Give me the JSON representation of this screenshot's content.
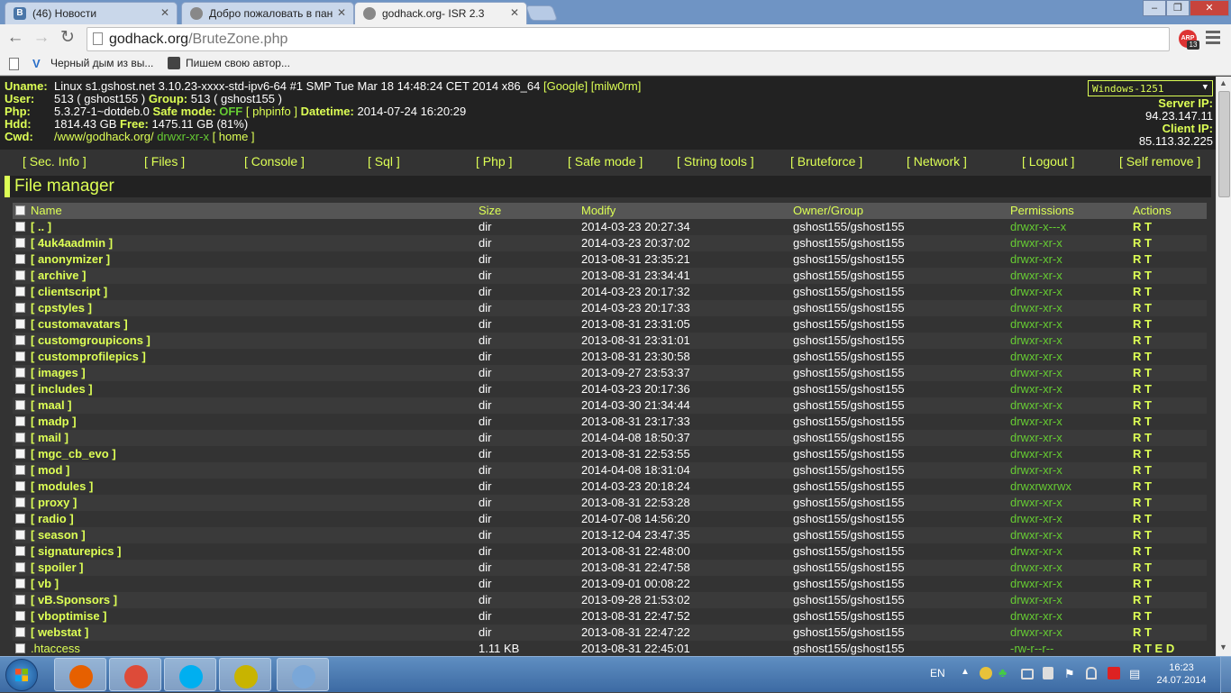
{
  "browser": {
    "tabs": [
      {
        "title": "(46) Новости",
        "icon": "vk-icon",
        "color": "#4a76a8"
      },
      {
        "title": "Добро пожаловать в пан",
        "icon": "page-icon",
        "color": "#888888"
      },
      {
        "title": "godhack.org- ISR 2.3",
        "icon": "page-icon",
        "color": "#888888"
      }
    ],
    "url_host": "godhack.org",
    "url_path": "/BruteZone.php",
    "extension_label": "ARP",
    "extension_badge": "13",
    "bookmarks": [
      {
        "label": "Черный дым из вы...",
        "icon": "bookmark-v-icon"
      },
      {
        "label": "Пишем свою автор...",
        "icon": "bookmark-avatar-icon"
      }
    ]
  },
  "info": {
    "uname_label": "Uname:",
    "uname_value": "Linux s1.gshost.net 3.10.23-xxxx-std-ipv6-64 #1 SMP Tue Mar 18 14:48:24 CET 2014 x86_64",
    "uname_google": "[Google]",
    "uname_milw0rm": "[milw0rm]",
    "user_label": "User:",
    "user_value": "513 ( gshost155 )",
    "group_label": "Group:",
    "group_value": "513 ( gshost155 )",
    "php_label": "Php:",
    "php_value": "5.3.27-1~dotdeb.0",
    "safe_label": "Safe mode:",
    "safe_value": "OFF",
    "phpinfo": "[ phpinfo ]",
    "datetime_label": "Datetime:",
    "datetime_value": "2014-07-24 16:20:29",
    "hdd_label": "Hdd:",
    "hdd_value": "1814.43 GB",
    "free_label": "Free:",
    "free_value": "1475.11 GB (81%)",
    "cwd_label": "Cwd:",
    "cwd_value": "/www/godhack.org/",
    "cwd_perm": "drwxr-xr-x",
    "cwd_home": "[ home ]",
    "encoding": "Windows-1251",
    "server_ip_label": "Server IP:",
    "server_ip": "94.23.147.11",
    "client_ip_label": "Client IP:",
    "client_ip": "85.113.32.225"
  },
  "menu": [
    "[ Sec. Info ]",
    "[ Files ]",
    "[ Console ]",
    "[ Sql ]",
    "[ Php ]",
    "[ Safe mode ]",
    "[ String tools ]",
    "[ Bruteforce ]",
    "[ Network ]",
    "[ Logout ]",
    "[ Self remove ]"
  ],
  "file_manager": {
    "title": "File manager",
    "columns": {
      "name": "Name",
      "size": "Size",
      "modify": "Modify",
      "owner": "Owner/Group",
      "perms": "Permissions",
      "actions": "Actions"
    },
    "rows": [
      {
        "name": "[ .. ]",
        "size": "dir",
        "modify": "2014-03-23 20:27:34",
        "owner": "gshost155/gshost155",
        "perms": "drwxr-x---x",
        "actions": "R T"
      },
      {
        "name": "[ 4uk4aadmin ]",
        "size": "dir",
        "modify": "2014-03-23 20:37:02",
        "owner": "gshost155/gshost155",
        "perms": "drwxr-xr-x",
        "actions": "R T"
      },
      {
        "name": "[ anonymizer ]",
        "size": "dir",
        "modify": "2013-08-31 23:35:21",
        "owner": "gshost155/gshost155",
        "perms": "drwxr-xr-x",
        "actions": "R T"
      },
      {
        "name": "[ archive ]",
        "size": "dir",
        "modify": "2013-08-31 23:34:41",
        "owner": "gshost155/gshost155",
        "perms": "drwxr-xr-x",
        "actions": "R T"
      },
      {
        "name": "[ clientscript ]",
        "size": "dir",
        "modify": "2014-03-23 20:17:32",
        "owner": "gshost155/gshost155",
        "perms": "drwxr-xr-x",
        "actions": "R T"
      },
      {
        "name": "[ cpstyles ]",
        "size": "dir",
        "modify": "2014-03-23 20:17:33",
        "owner": "gshost155/gshost155",
        "perms": "drwxr-xr-x",
        "actions": "R T"
      },
      {
        "name": "[ customavatars ]",
        "size": "dir",
        "modify": "2013-08-31 23:31:05",
        "owner": "gshost155/gshost155",
        "perms": "drwxr-xr-x",
        "actions": "R T"
      },
      {
        "name": "[ customgroupicons ]",
        "size": "dir",
        "modify": "2013-08-31 23:31:01",
        "owner": "gshost155/gshost155",
        "perms": "drwxr-xr-x",
        "actions": "R T"
      },
      {
        "name": "[ customprofilepics ]",
        "size": "dir",
        "modify": "2013-08-31 23:30:58",
        "owner": "gshost155/gshost155",
        "perms": "drwxr-xr-x",
        "actions": "R T"
      },
      {
        "name": "[ images ]",
        "size": "dir",
        "modify": "2013-09-27 23:53:37",
        "owner": "gshost155/gshost155",
        "perms": "drwxr-xr-x",
        "actions": "R T"
      },
      {
        "name": "[ includes ]",
        "size": "dir",
        "modify": "2014-03-23 20:17:36",
        "owner": "gshost155/gshost155",
        "perms": "drwxr-xr-x",
        "actions": "R T"
      },
      {
        "name": "[ maal ]",
        "size": "dir",
        "modify": "2014-03-30 21:34:44",
        "owner": "gshost155/gshost155",
        "perms": "drwxr-xr-x",
        "actions": "R T"
      },
      {
        "name": "[ madp ]",
        "size": "dir",
        "modify": "2013-08-31 23:17:33",
        "owner": "gshost155/gshost155",
        "perms": "drwxr-xr-x",
        "actions": "R T"
      },
      {
        "name": "[ mail ]",
        "size": "dir",
        "modify": "2014-04-08 18:50:37",
        "owner": "gshost155/gshost155",
        "perms": "drwxr-xr-x",
        "actions": "R T"
      },
      {
        "name": "[ mgc_cb_evo ]",
        "size": "dir",
        "modify": "2013-08-31 22:53:55",
        "owner": "gshost155/gshost155",
        "perms": "drwxr-xr-x",
        "actions": "R T"
      },
      {
        "name": "[ mod ]",
        "size": "dir",
        "modify": "2014-04-08 18:31:04",
        "owner": "gshost155/gshost155",
        "perms": "drwxr-xr-x",
        "actions": "R T"
      },
      {
        "name": "[ modules ]",
        "size": "dir",
        "modify": "2014-03-23 20:18:24",
        "owner": "gshost155/gshost155",
        "perms": "drwxrwxrwx",
        "actions": "R T"
      },
      {
        "name": "[ proxy ]",
        "size": "dir",
        "modify": "2013-08-31 22:53:28",
        "owner": "gshost155/gshost155",
        "perms": "drwxr-xr-x",
        "actions": "R T"
      },
      {
        "name": "[ radio ]",
        "size": "dir",
        "modify": "2014-07-08 14:56:20",
        "owner": "gshost155/gshost155",
        "perms": "drwxr-xr-x",
        "actions": "R T"
      },
      {
        "name": "[ season ]",
        "size": "dir",
        "modify": "2013-12-04 23:47:35",
        "owner": "gshost155/gshost155",
        "perms": "drwxr-xr-x",
        "actions": "R T"
      },
      {
        "name": "[ signaturepics ]",
        "size": "dir",
        "modify": "2013-08-31 22:48:00",
        "owner": "gshost155/gshost155",
        "perms": "drwxr-xr-x",
        "actions": "R T"
      },
      {
        "name": "[ spoiler ]",
        "size": "dir",
        "modify": "2013-08-31 22:47:58",
        "owner": "gshost155/gshost155",
        "perms": "drwxr-xr-x",
        "actions": "R T"
      },
      {
        "name": "[ vb ]",
        "size": "dir",
        "modify": "2013-09-01 00:08:22",
        "owner": "gshost155/gshost155",
        "perms": "drwxr-xr-x",
        "actions": "R T"
      },
      {
        "name": "[ vB.Sponsors ]",
        "size": "dir",
        "modify": "2013-09-28 21:53:02",
        "owner": "gshost155/gshost155",
        "perms": "drwxr-xr-x",
        "actions": "R T"
      },
      {
        "name": "[ vboptimise ]",
        "size": "dir",
        "modify": "2013-08-31 22:47:52",
        "owner": "gshost155/gshost155",
        "perms": "drwxr-xr-x",
        "actions": "R T"
      },
      {
        "name": "[ webstat ]",
        "size": "dir",
        "modify": "2013-08-31 22:47:22",
        "owner": "gshost155/gshost155",
        "perms": "drwxr-xr-x",
        "actions": "R T"
      },
      {
        "name": ".htaccess",
        "size": "1.11 KB",
        "modify": "2013-08-31 22:45:01",
        "owner": "gshost155/gshost155",
        "perms": "-rw-r--r--",
        "actions": "R T E D"
      }
    ]
  },
  "taskbar": {
    "apps": [
      {
        "name": "firefox-icon",
        "color": "#e66000"
      },
      {
        "name": "chrome-icon",
        "color": "#dd4b39"
      },
      {
        "name": "skype-icon",
        "color": "#00aff0"
      },
      {
        "name": "game-icon",
        "color": "#c8b400"
      },
      {
        "name": "paint-icon",
        "color": "#7aa7d8"
      }
    ],
    "language": "EN",
    "time": "16:23",
    "date": "24.07.2014"
  },
  "colors": {
    "accent": "#ddff55",
    "perm_green": "#66cc33",
    "page_bg": "#333333",
    "info_bg": "#222222"
  }
}
